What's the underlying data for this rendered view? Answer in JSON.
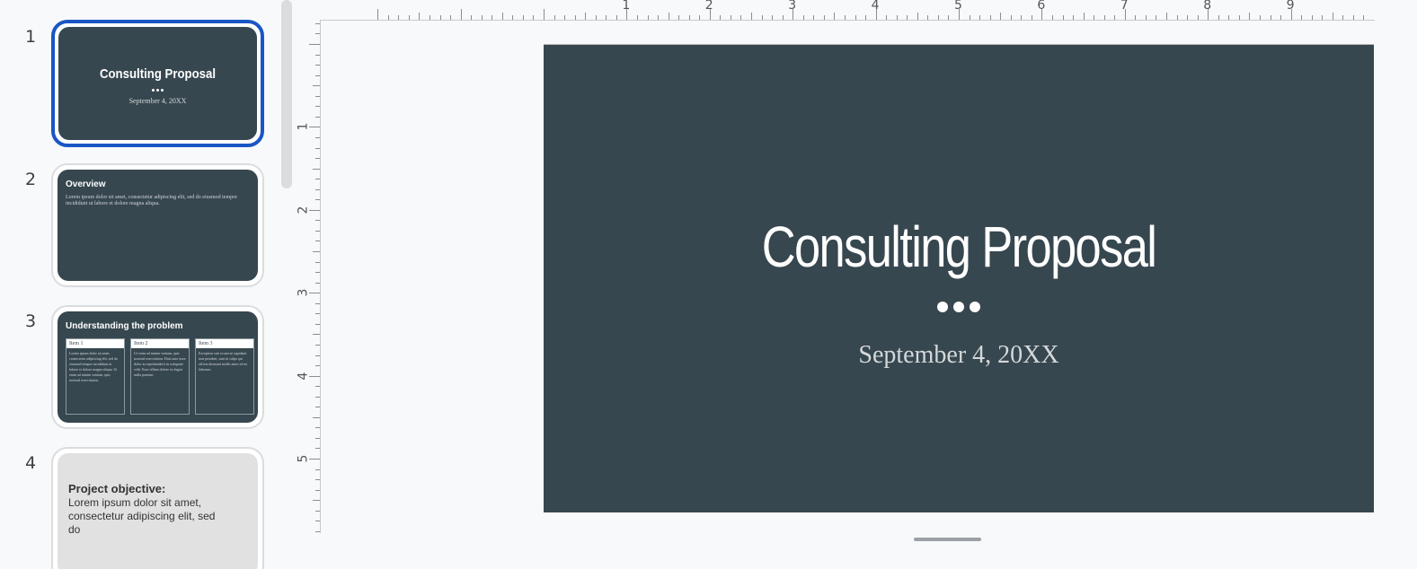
{
  "filmstrip": {
    "slides": [
      {
        "number": "1",
        "title": "Consulting Proposal",
        "subtitle": "September 4, 20XX"
      },
      {
        "number": "2",
        "title": "Overview",
        "body": "Lorem ipsum dolor sit amet, consectetur adipiscing elit, sed do eiusmod tempor incididunt ut labore et dolore magna aliqua."
      },
      {
        "number": "3",
        "title": "Understanding the problem",
        "columns": [
          {
            "head": "Item 1",
            "body": "Lorem ipsum dolor sit amet, consectetur adipiscing elit, sed do eiusmod tempor incididunt ut labore et dolore magna aliqua. Ut enim ad minim veniam, quis nostrud exercitation."
          },
          {
            "head": "Item 2",
            "body": "Ut enim ad minim veniam, quis nostrud exercitation. Duis aute irure dolor in reprehenderit in voluptate velit. Esse cillum dolore eu fugiat nulla pariatur."
          },
          {
            "head": "Item 3",
            "body": "Excepteur sint occaecat cupidatat non proident, sunt in culpa qui officia deserunt mollit anim id est laborum."
          }
        ]
      },
      {
        "number": "4",
        "heading": "Project objective:",
        "body": "Lorem ipsum dolor sit amet, consectetur adipiscing elit, sed do"
      }
    ]
  },
  "ruler": {
    "horizontal": [
      "1",
      "2",
      "3",
      "4",
      "5",
      "6",
      "7",
      "8",
      "9"
    ],
    "vertical": [
      "1",
      "2",
      "3",
      "4",
      "5"
    ]
  },
  "slide": {
    "title": "Consulting Proposal",
    "subtitle": "September 4, 20XX"
  },
  "colors": {
    "slide_background": "#37474f",
    "selection": "#1a56c4"
  }
}
